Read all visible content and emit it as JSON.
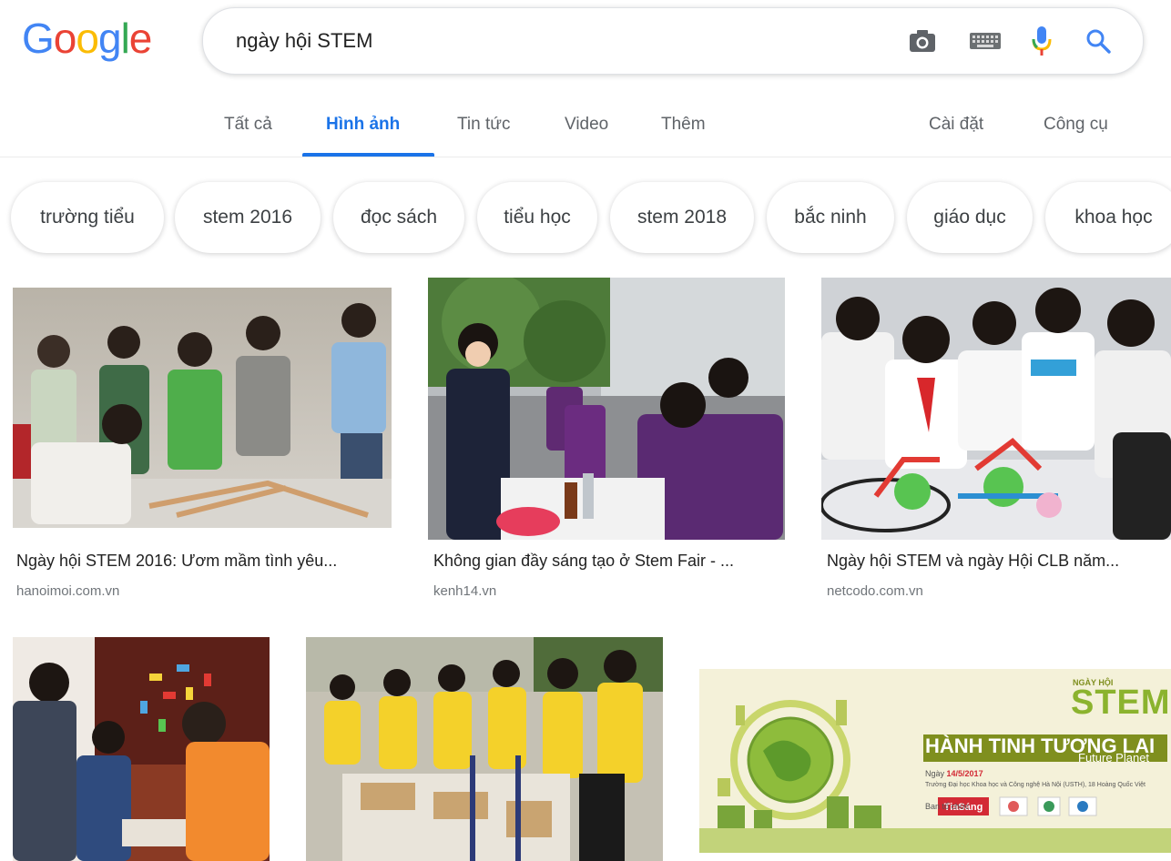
{
  "logo": {
    "letters": [
      "G",
      "o",
      "o",
      "g",
      "l",
      "e"
    ],
    "colors": [
      "#4285f4",
      "#ea4335",
      "#fbbc05",
      "#4285f4",
      "#34a853",
      "#ea4335"
    ]
  },
  "search": {
    "value": "ngày hội STEM"
  },
  "tabs": [
    {
      "label": "Tất cả"
    },
    {
      "label": "Hình ảnh"
    },
    {
      "label": "Tin tức"
    },
    {
      "label": "Video"
    },
    {
      "label": "Thêm"
    }
  ],
  "settings": {
    "label": "Cài đặt"
  },
  "tools": {
    "label": "Công cụ"
  },
  "chips": [
    "trường tiểu",
    "stem 2016",
    "đọc sách",
    "tiểu học",
    "stem 2018",
    "bắc ninh",
    "giáo dục",
    "khoa học"
  ],
  "results": [
    {
      "title": "Ngày hội STEM 2016: Ươm mầm tình yêu...",
      "source": "hanoimoi.com.vn"
    },
    {
      "title": "Không gian đầy sáng tạo ở Stem Fair - ...",
      "source": "kenh14.vn"
    },
    {
      "title": "Ngày hội STEM và ngày Hội CLB năm...",
      "source": "netcodo.com.vn"
    }
  ],
  "poster": {
    "small": "NGÀY HỘI",
    "stem": "STEM",
    "headline": "HÀNH TINH TƯƠNG LAI",
    "sub": "Future Planet",
    "date_label": "Ngày",
    "date": "14/5/2017",
    "venue": "Trường Đại học Khoa học và Công nghệ Hà Nội (USTH), 18 Hoàng Quốc Việt",
    "organizer": "Ban tổ chức",
    "sponsor": "TiaSáng"
  },
  "accent": "#1a73e8"
}
